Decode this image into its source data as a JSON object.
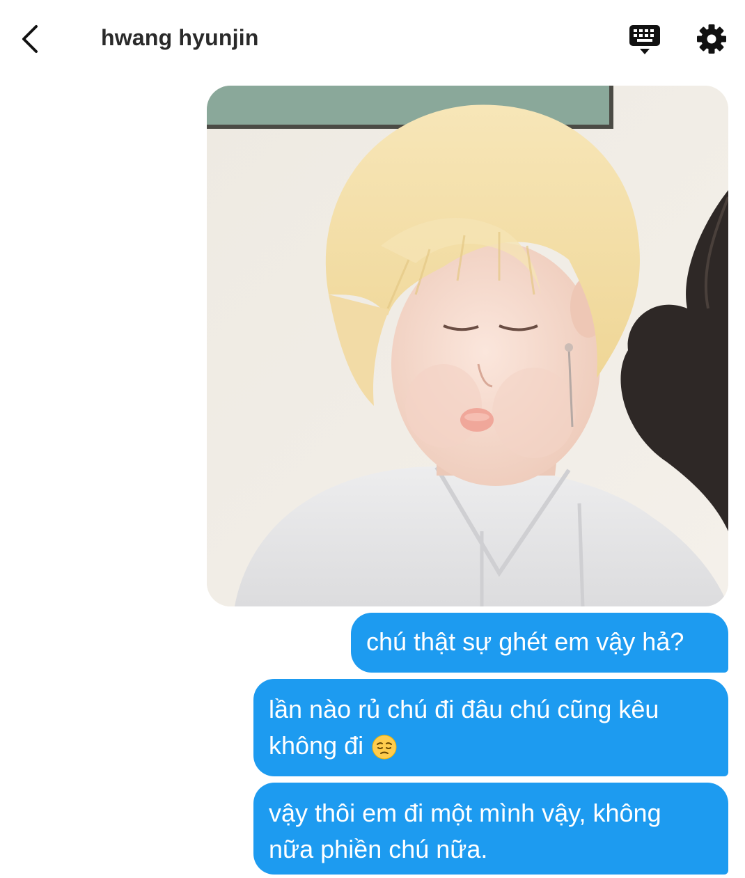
{
  "header": {
    "title": "hwang hyunjin",
    "back_icon": "chevron-left-icon",
    "keyboard_icon": "keyboard-icon",
    "settings_icon": "gear-icon"
  },
  "messages": [
    {
      "type": "image",
      "description_icon": "photo"
    },
    {
      "type": "text",
      "text": "chú thật sự ghét em vậy hả?"
    },
    {
      "type": "text",
      "line1": "lần nào rủ chú đi đâu chú cũng kêu",
      "line2": "không đi",
      "emoji": "pensive-face-emoji"
    },
    {
      "type": "text",
      "line1": "vậy thôi em đi một mình vậy, không",
      "line2": "nữa phiền chú nữa."
    }
  ],
  "colors": {
    "bubble": "#1d9bf0",
    "bubble_text": "#ffffff",
    "title": "#2a2a2a"
  }
}
